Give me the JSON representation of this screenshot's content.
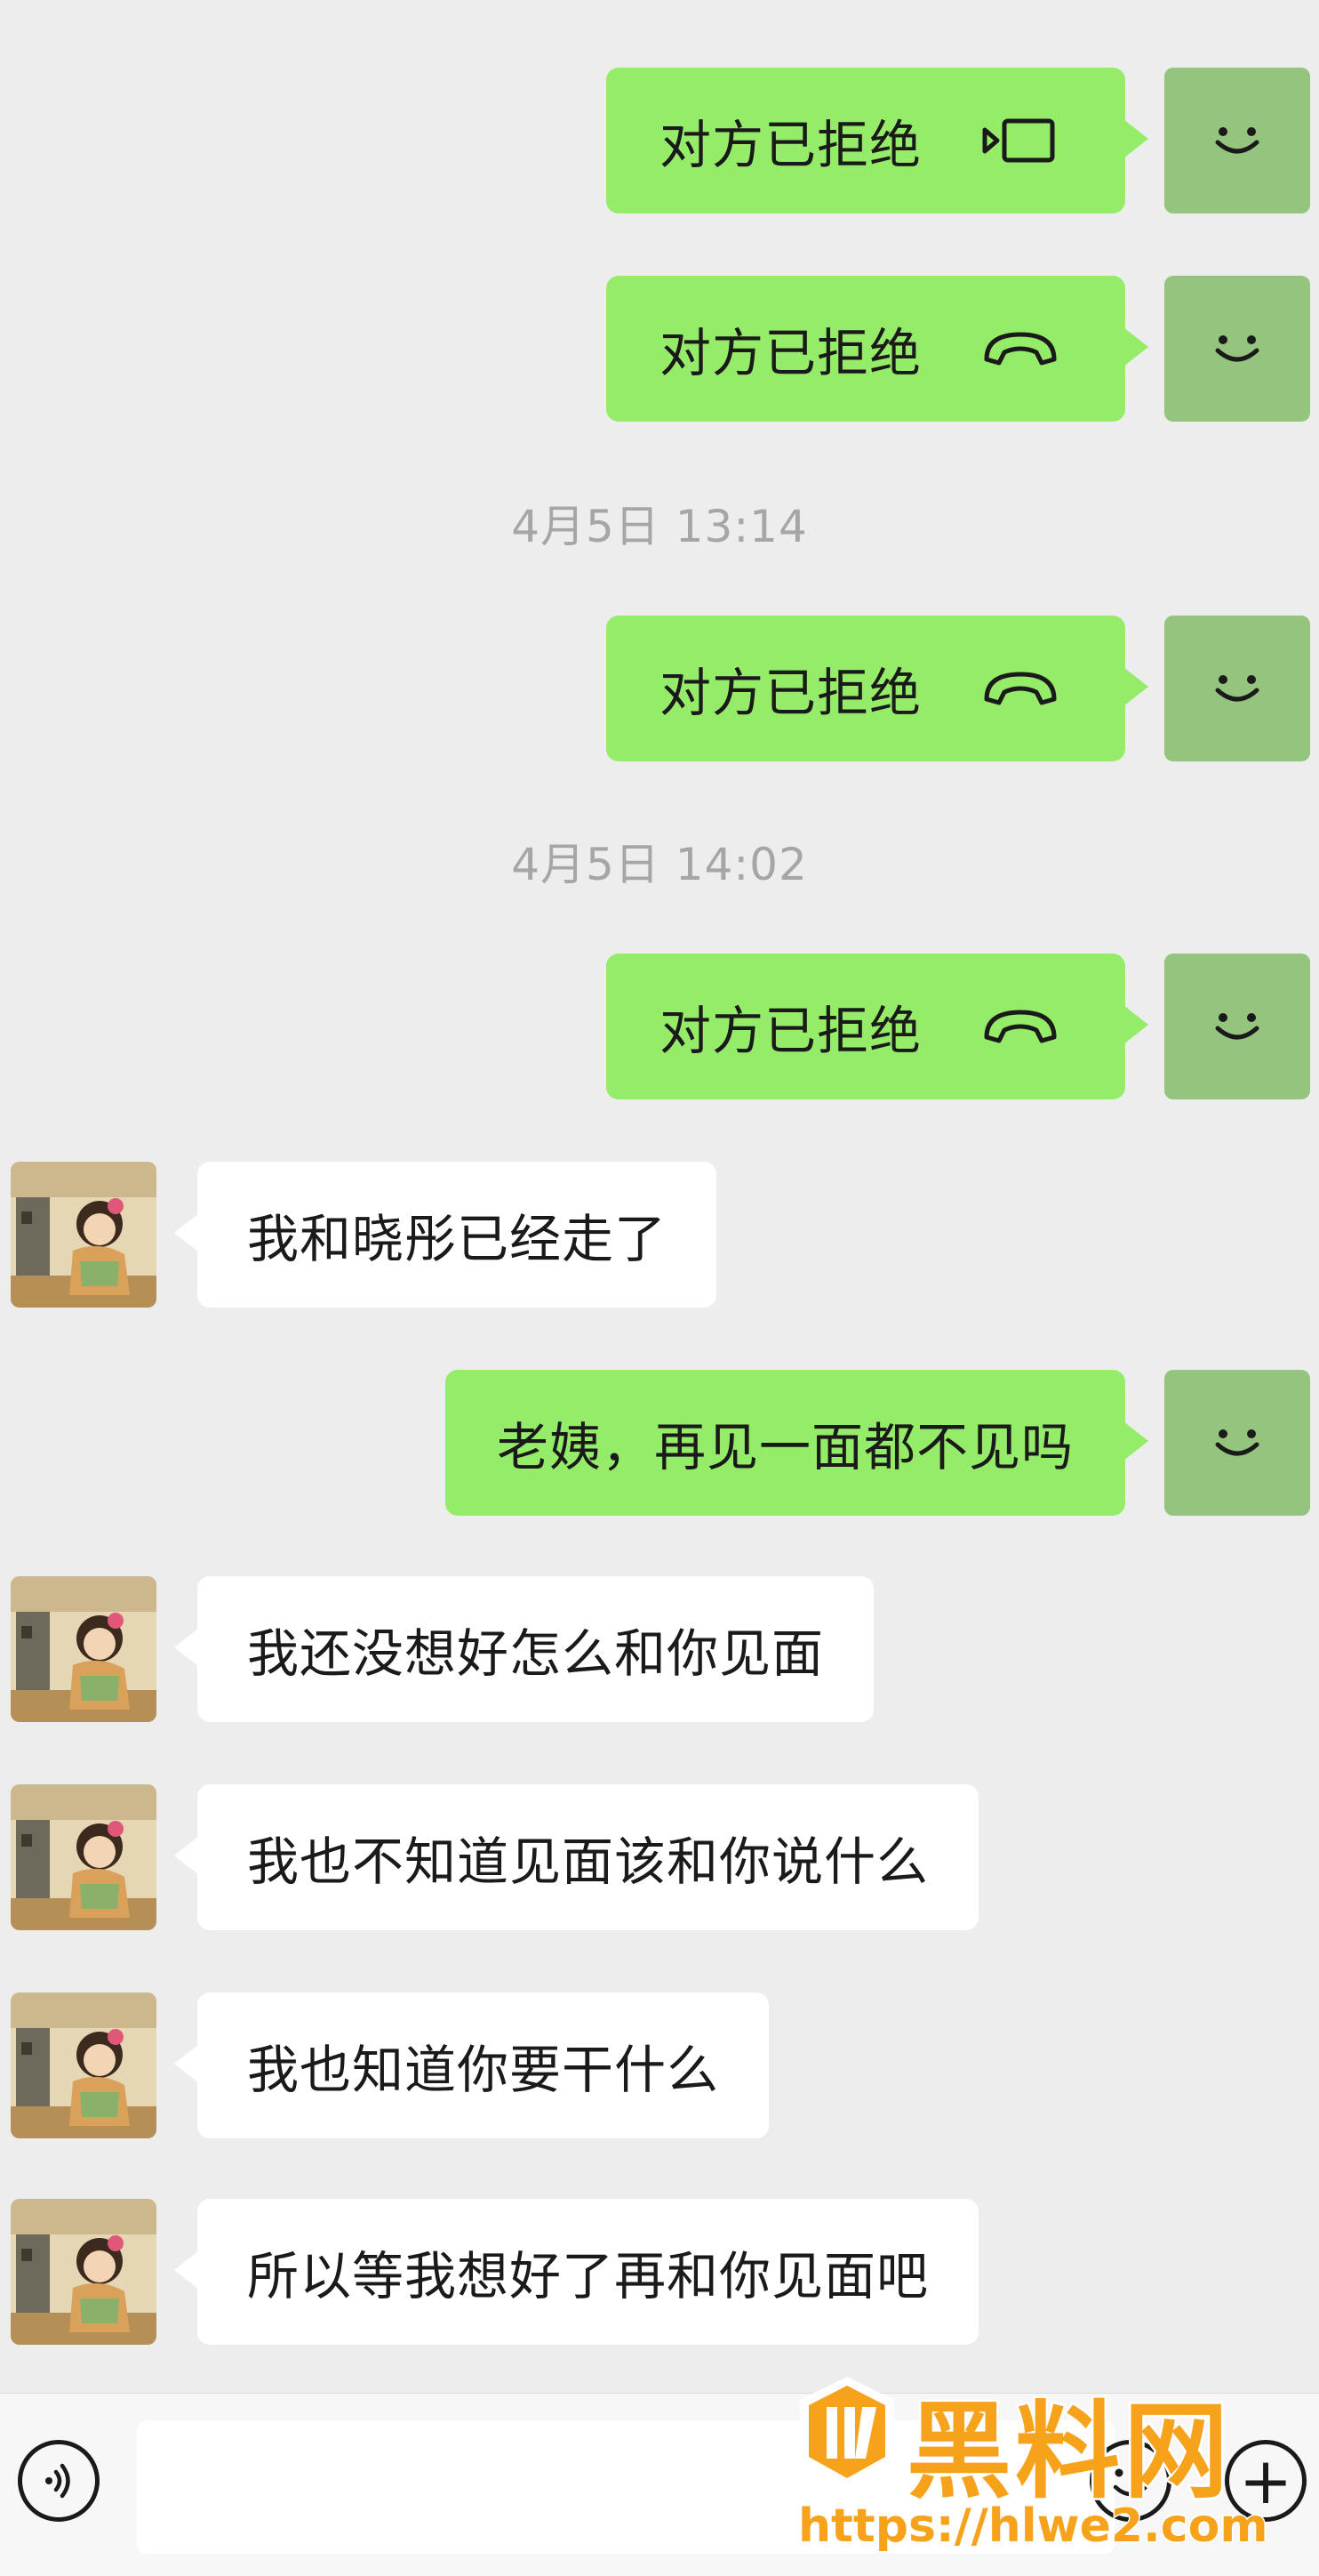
{
  "messages": [
    {
      "side": "me",
      "kind": "call",
      "text": "对方已拒绝",
      "icon": "video-call-icon"
    },
    {
      "side": "me",
      "kind": "call",
      "text": "对方已拒绝",
      "icon": "phone-hangup-icon"
    },
    {
      "kind": "timestamp",
      "text": "4月5日 13:14"
    },
    {
      "side": "me",
      "kind": "call",
      "text": "对方已拒绝",
      "icon": "phone-hangup-icon"
    },
    {
      "kind": "timestamp",
      "text": "4月5日 14:02"
    },
    {
      "side": "me",
      "kind": "call",
      "text": "对方已拒绝",
      "icon": "phone-hangup-icon"
    },
    {
      "side": "other",
      "kind": "text",
      "text": "我和晓彤已经走了"
    },
    {
      "side": "me",
      "kind": "text",
      "text": "老姨，再见一面都不见吗"
    },
    {
      "side": "other",
      "kind": "text",
      "text": "我还没想好怎么和你见面"
    },
    {
      "side": "other",
      "kind": "text",
      "text": "我也不知道见面该和你说什么"
    },
    {
      "side": "other",
      "kind": "text",
      "text": "我也知道你要干什么"
    },
    {
      "side": "other",
      "kind": "text",
      "text": "所以等我想好了再和你见面吧"
    }
  ],
  "input_bar": {
    "voice_icon": "voice-icon",
    "emoji_icon": "emoji-icon",
    "plus_icon": "plus-icon",
    "plus_glyph": "+"
  },
  "watermark": {
    "title": "黑料网",
    "url": "https://hlwe2.com"
  },
  "colors": {
    "background": "#ededed",
    "bubble_me": "#95ec69",
    "bubble_other": "#ffffff",
    "avatar_me": "#95c47e",
    "watermark": "#f7a21b",
    "timestamp_text": "#a6a6a6"
  }
}
